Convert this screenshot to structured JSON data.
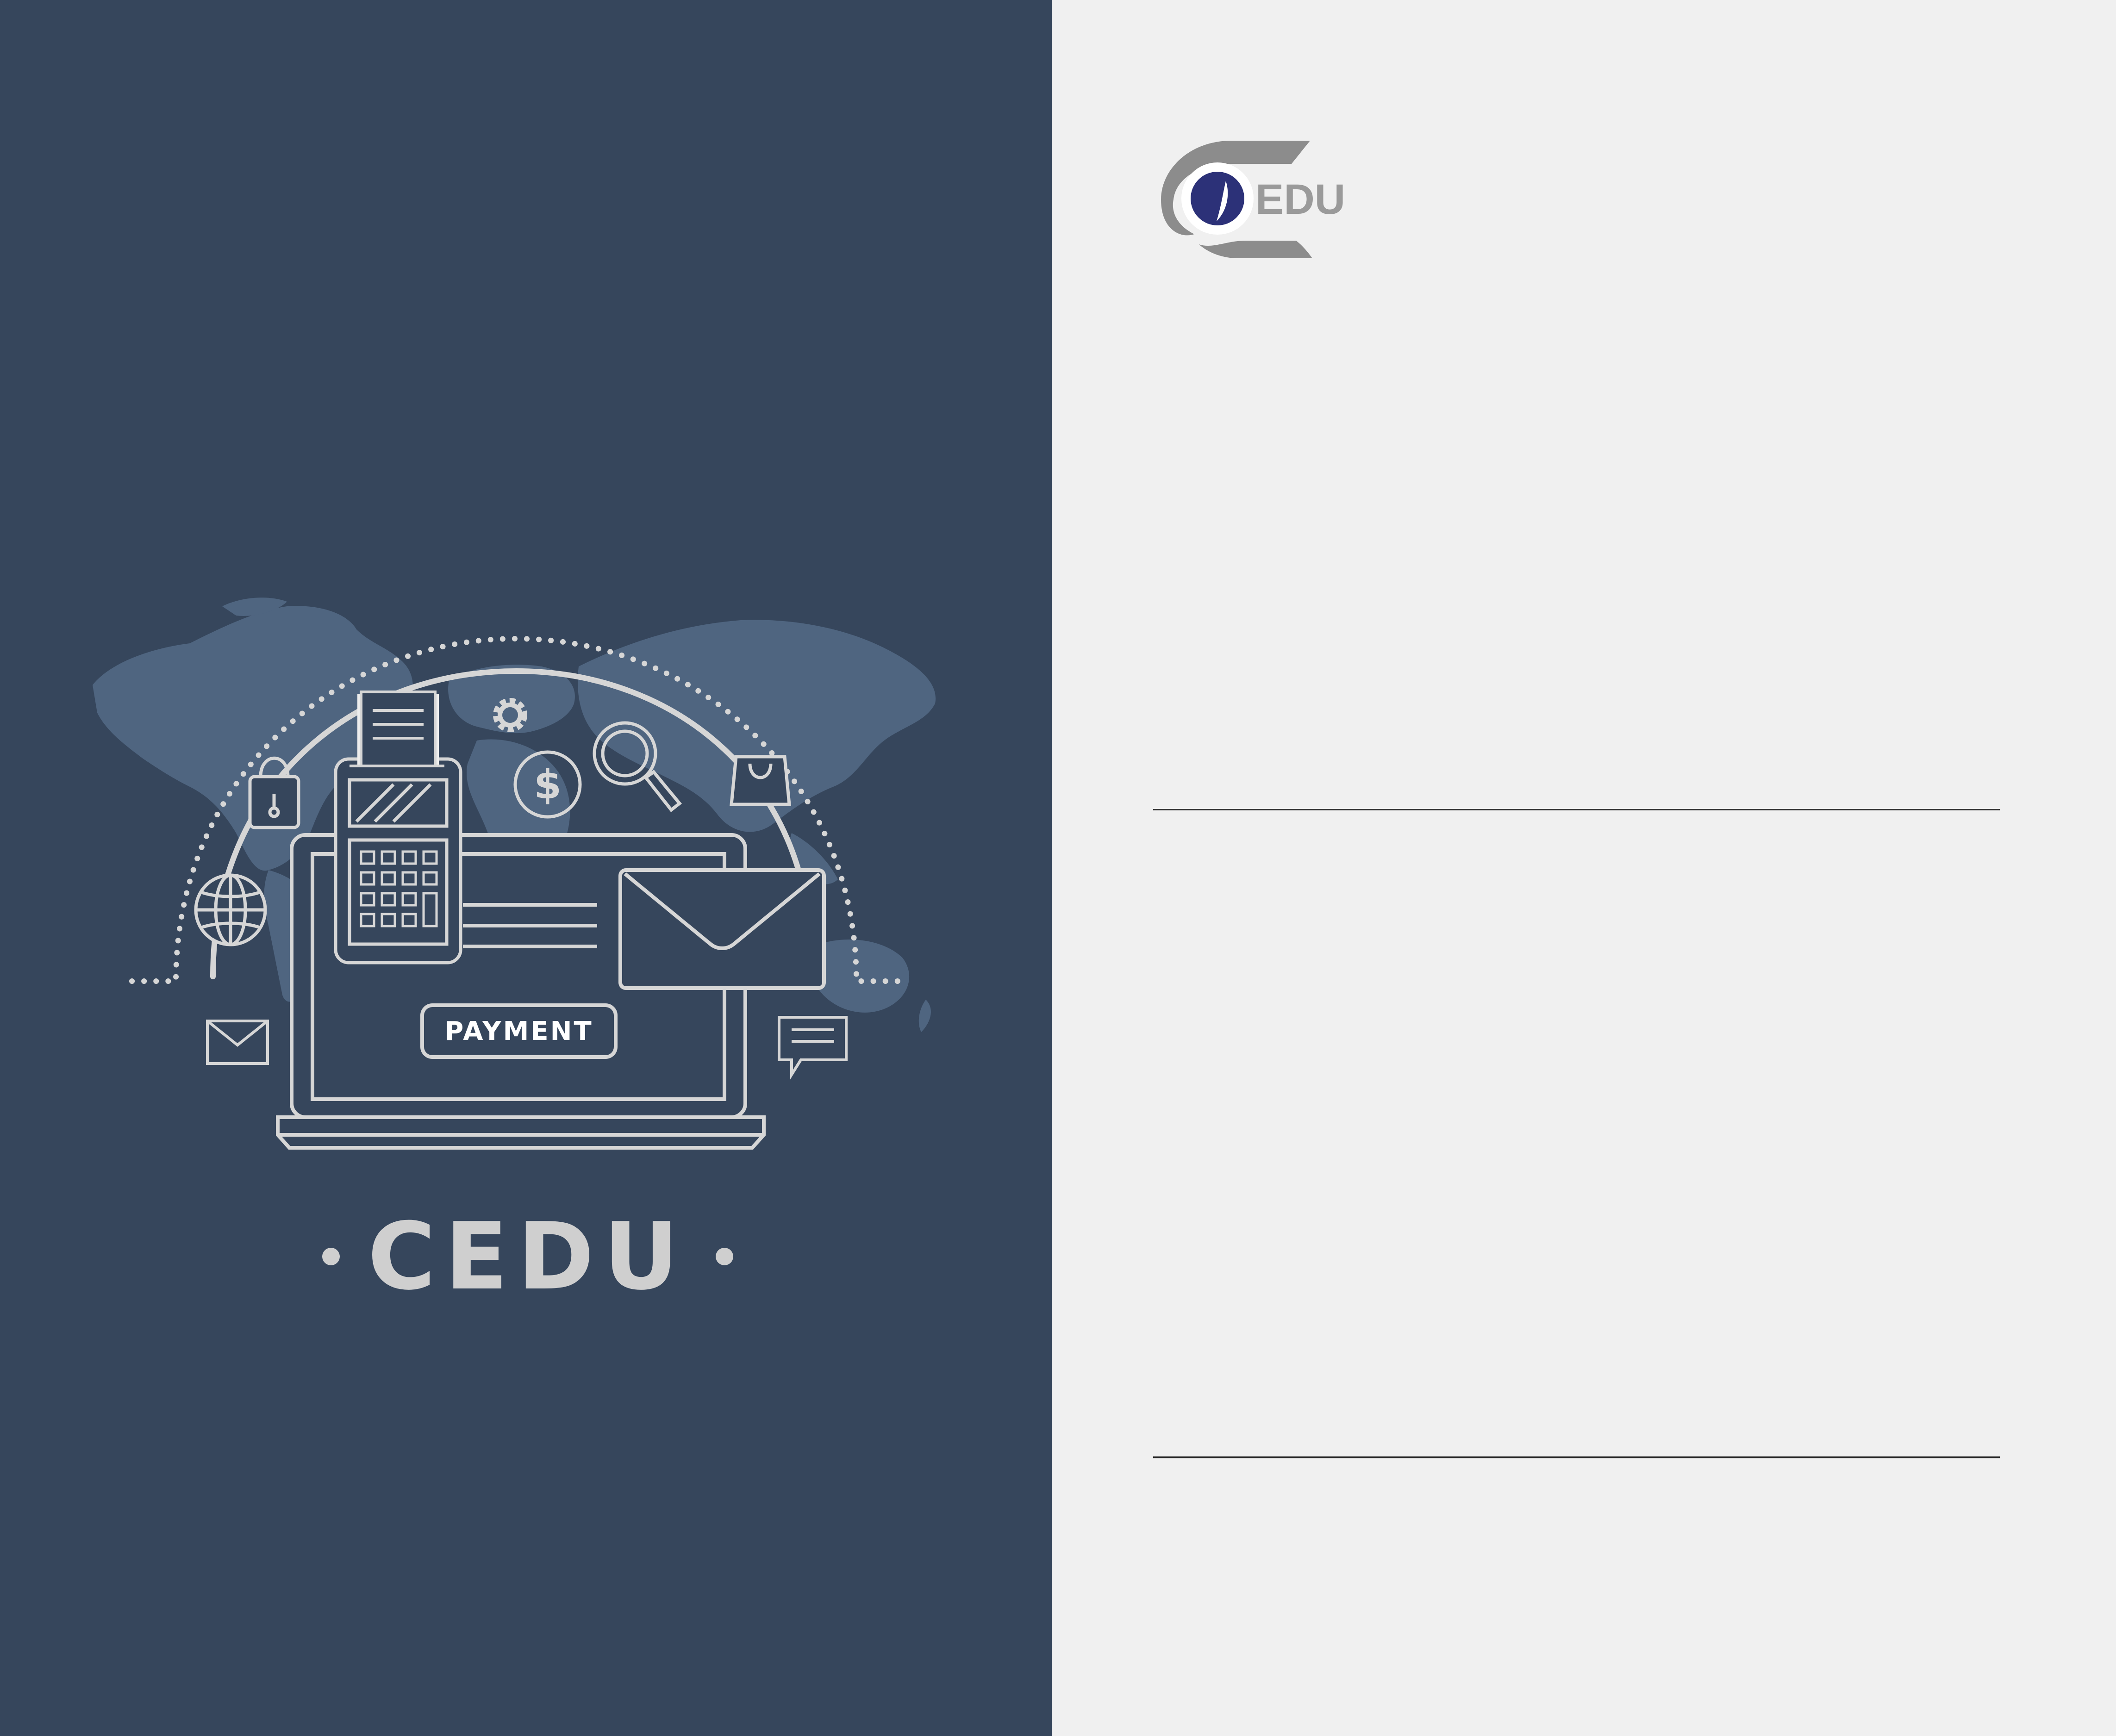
{
  "illustration": {
    "payment_button_label": "PAYMENT"
  },
  "brand": {
    "title": "CEDU"
  },
  "logo": {
    "text": "EDU"
  },
  "colors": {
    "left_panel_bg": "#36465c",
    "right_panel_bg": "#f0f0f0",
    "line_art": "#d6d6d6",
    "map_fill": "#4f6580",
    "logo_gray": "#8c8c8c",
    "logo_accent": "#2c3178"
  },
  "icons": [
    "world-map-icon",
    "laptop-icon",
    "pos-terminal-icon",
    "receipt-icon",
    "gear-icon",
    "dollar-coin-icon",
    "magnifier-icon",
    "shopping-bag-icon",
    "padlock-icon",
    "globe-icon",
    "envelope-icon",
    "chat-bubble-icon"
  ]
}
